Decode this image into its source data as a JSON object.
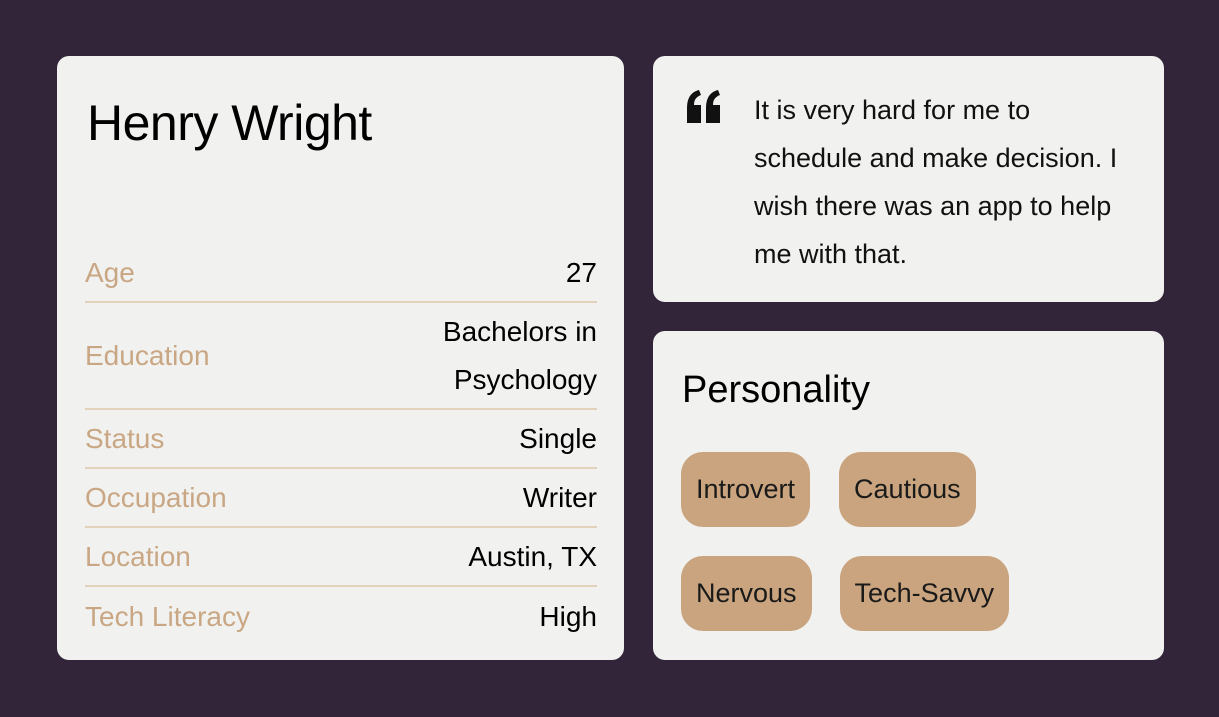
{
  "colors": {
    "background": "#32253a",
    "card": "#f1f1ef",
    "label": "#c9a784",
    "divider": "#e2d2b9",
    "tag": "#c9a47e"
  },
  "profile": {
    "name": "Henry Wright",
    "details": [
      {
        "label": "Age",
        "value": "27"
      },
      {
        "label": "Education",
        "value": "Bachelors in Psychology"
      },
      {
        "label": "Status",
        "value": "Single"
      },
      {
        "label": "Occupation",
        "value": "Writer"
      },
      {
        "label": "Location",
        "value": "Austin, TX"
      },
      {
        "label": "Tech Literacy",
        "value": "High"
      }
    ]
  },
  "quote": {
    "icon": "quote-icon",
    "text": "It is very hard for me to schedule and make decision. I wish there was an app to help me with that."
  },
  "personality": {
    "title": "Personality",
    "traits": [
      "Introvert",
      "Cautious",
      "Nervous",
      "Tech-Savvy"
    ]
  }
}
